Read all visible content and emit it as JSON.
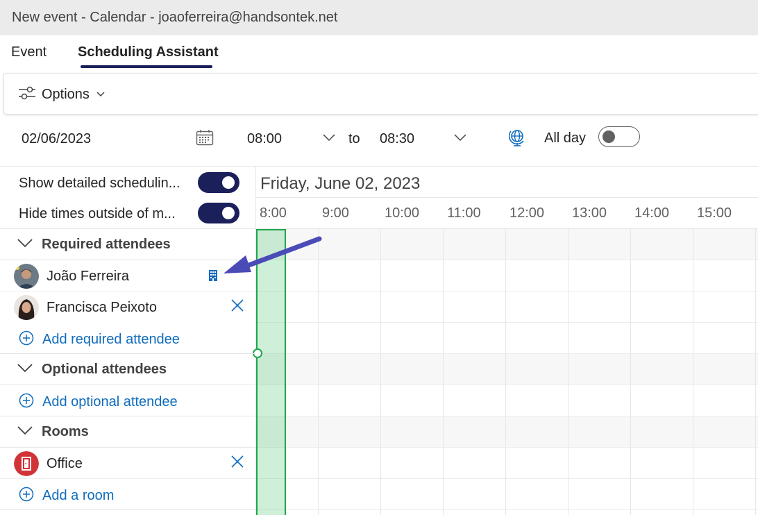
{
  "window": {
    "title": "New event - Calendar - joaoferreira@handsontek.net"
  },
  "tabs": [
    {
      "label": "Event"
    },
    {
      "label": "Scheduling Assistant",
      "active": true
    }
  ],
  "toolbar": {
    "options_label": "Options",
    "icon": "sliders-icon"
  },
  "datetime": {
    "date": "02/06/2023",
    "start": "08:00",
    "to": "to",
    "end": "08:30",
    "all_day_label": "All day",
    "all_day_on": false
  },
  "settings": [
    {
      "label": "Show detailed schedulin...",
      "on": true
    },
    {
      "label": "Hide times outside of m...",
      "on": true
    }
  ],
  "sections": {
    "required": {
      "label": "Required attendees",
      "people": [
        {
          "name": "João Ferreira",
          "indicator": "building-icon"
        },
        {
          "name": "Francisca Peixoto",
          "indicator": "remove-icon"
        }
      ],
      "add_label": "Add required attendee"
    },
    "optional": {
      "label": "Optional attendees",
      "add_label": "Add optional attendee"
    },
    "rooms": {
      "label": "Rooms",
      "items": [
        {
          "name": "Office"
        }
      ],
      "add_label": "Add a room"
    }
  },
  "schedule": {
    "date_header": "Friday, June 02, 2023",
    "hours": [
      "8:00",
      "9:00",
      "10:00",
      "11:00",
      "12:00",
      "13:00",
      "14:00",
      "15:00"
    ]
  },
  "colors": {
    "accent_navy": "#1b1f5a",
    "link_blue": "#0f6cbd",
    "selection_green": "#1ea64a",
    "arrow_purple": "#4b4bb8",
    "room_red": "#d13438"
  }
}
